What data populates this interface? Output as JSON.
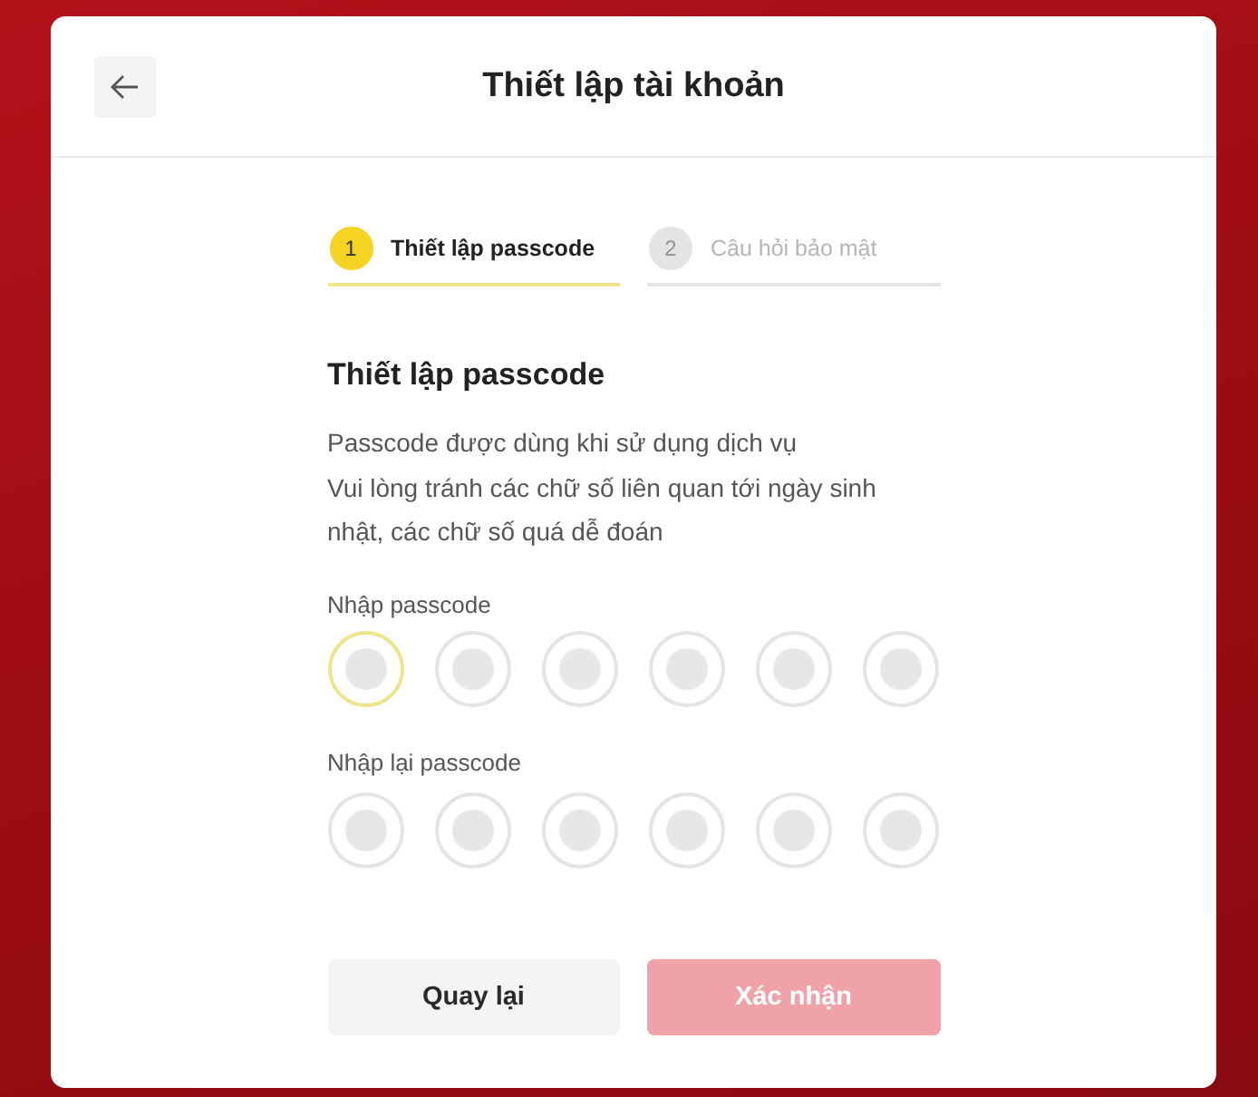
{
  "header": {
    "title": "Thiết lập tài khoản"
  },
  "steps": [
    {
      "number": "1",
      "label": "Thiết lập passcode",
      "selected": true
    },
    {
      "number": "2",
      "label": "Câu hỏi bảo mật",
      "selected": false
    }
  ],
  "section": {
    "title": "Thiết lập passcode",
    "description": [
      "Passcode được dùng khi sử dụng dịch vụ",
      "Vui lòng tránh các chữ số liên quan tới ngày sinh nhật, các chữ số quá dễ đoán"
    ]
  },
  "passcode_fields": [
    {
      "label": "Nhập passcode",
      "digits": [
        {
          "focused": true
        },
        {
          "focused": false
        },
        {
          "focused": false
        },
        {
          "focused": false
        },
        {
          "focused": false
        },
        {
          "focused": false
        }
      ]
    },
    {
      "label": "Nhập lại passcode",
      "digits": [
        {
          "focused": false
        },
        {
          "focused": false
        },
        {
          "focused": false
        },
        {
          "focused": false
        },
        {
          "focused": false
        },
        {
          "focused": false
        }
      ]
    }
  ],
  "buttons": [
    {
      "label": "Quay lại",
      "kind": "secondary",
      "disabled": false
    },
    {
      "label": "Xác nhận",
      "kind": "primary",
      "disabled": true
    }
  ]
}
